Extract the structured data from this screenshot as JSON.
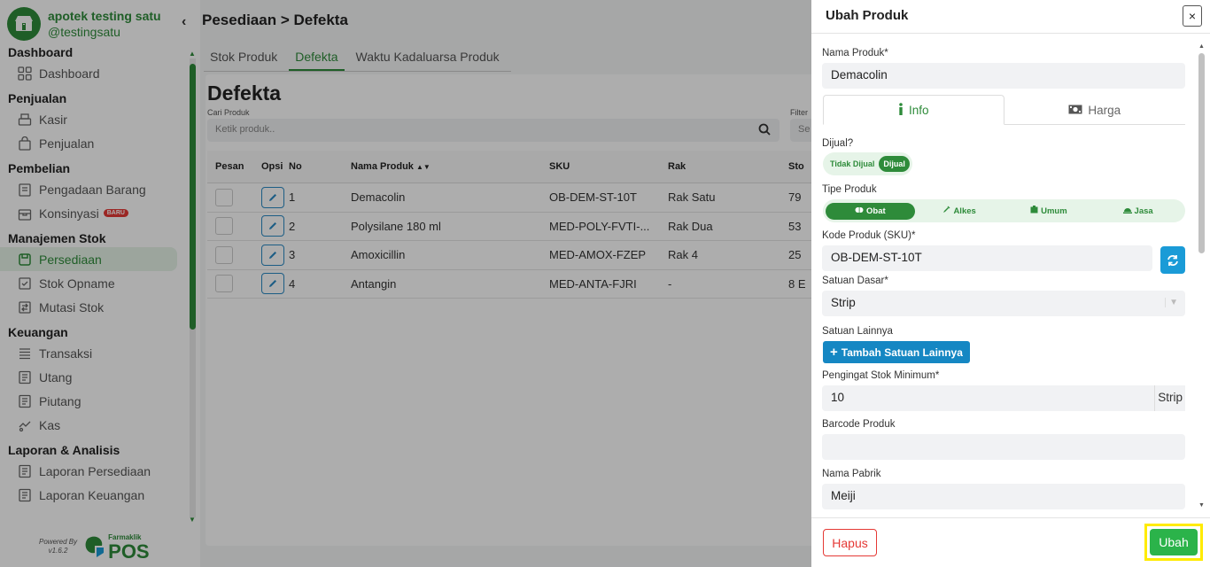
{
  "app": {
    "brand_name": "apotek testing satu",
    "brand_user": "@testingsatu"
  },
  "sidebar": {
    "groups": [
      {
        "title": "Dashboard",
        "items": [
          {
            "label": "Dashboard"
          }
        ]
      },
      {
        "title": "Penjualan",
        "items": [
          {
            "label": "Kasir"
          },
          {
            "label": "Penjualan"
          }
        ]
      },
      {
        "title": "Pembelian",
        "items": [
          {
            "label": "Pengadaan Barang"
          },
          {
            "label": "Konsinyasi",
            "badge": "BARU"
          }
        ]
      },
      {
        "title": "Manajemen Stok",
        "items": [
          {
            "label": "Persediaan",
            "active": true
          },
          {
            "label": "Stok Opname"
          },
          {
            "label": "Mutasi Stok"
          }
        ]
      },
      {
        "title": "Keuangan",
        "items": [
          {
            "label": "Transaksi"
          },
          {
            "label": "Utang"
          },
          {
            "label": "Piutang"
          },
          {
            "label": "Kas"
          }
        ]
      },
      {
        "title": "Laporan & Analisis",
        "items": [
          {
            "label": "Laporan Persediaan"
          },
          {
            "label": "Laporan Keuangan"
          }
        ]
      }
    ],
    "powered_by": "Powered By",
    "version": "v1.6.2",
    "footer_brand_small": "Farmaklik",
    "footer_brand_big": "POS"
  },
  "page": {
    "breadcrumb": "Pesediaan > Defekta",
    "tabs": [
      {
        "label": "Stok Produk"
      },
      {
        "label": "Defekta",
        "active": true
      },
      {
        "label": "Waktu Kadaluarsa Produk"
      }
    ],
    "title": "Defekta",
    "search_label": "Cari Produk",
    "search_placeholder": "Ketik produk..",
    "filter_label": "Filter",
    "filter_value": "Se",
    "table": {
      "headers": {
        "pesan": "Pesan",
        "opsi": "Opsi",
        "no": "No",
        "nama": "Nama Produk",
        "sku": "SKU",
        "rak": "Rak",
        "stok": "Sto"
      },
      "rows": [
        {
          "no": "1",
          "nama": "Demacolin",
          "sku": "OB-DEM-ST-10T",
          "rak": "Rak Satu",
          "stok": "79"
        },
        {
          "no": "2",
          "nama": "Polysilane 180 ml",
          "sku": "MED-POLY-FVTI-...",
          "rak": "Rak Dua",
          "stok": "53"
        },
        {
          "no": "3",
          "nama": "Amoxicillin",
          "sku": "MED-AMOX-FZEP",
          "rak": "Rak 4",
          "stok": "25"
        },
        {
          "no": "4",
          "nama": "Antangin",
          "sku": "MED-ANTA-FJRI",
          "rak": "-",
          "stok": "8 E"
        }
      ]
    }
  },
  "modal": {
    "title": "Ubah Produk",
    "close_label": "×",
    "nama_produk_label": "Nama Produk*",
    "nama_produk_value": "Demacolin",
    "tab_info": "Info",
    "tab_harga": "Harga",
    "dijual_label": "Dijual?",
    "toggle_off": "Tidak Dijual",
    "toggle_on": "Dijual",
    "tipe_label": "Tipe Produk",
    "tipe_options": [
      {
        "label": "Obat",
        "active": true,
        "icon": "pills-icon"
      },
      {
        "label": "Alkes",
        "icon": "syringe-icon"
      },
      {
        "label": "Umum",
        "icon": "box-icon"
      },
      {
        "label": "Jasa",
        "icon": "tray-icon"
      }
    ],
    "sku_label": "Kode Produk (SKU)*",
    "sku_value": "OB-DEM-ST-10T",
    "satuan_dasar_label": "Satuan Dasar*",
    "satuan_dasar_value": "Strip",
    "satuan_lainnya_label": "Satuan Lainnya",
    "tambah_satuan_label": "Tambah Satuan Lainnya",
    "pengingat_label": "Pengingat Stok Minimum*",
    "pengingat_value": "10",
    "pengingat_unit": "Strip",
    "barcode_label": "Barcode Produk",
    "barcode_value": "",
    "pabrik_label": "Nama Pabrik",
    "pabrik_value": "Meiji",
    "hapus_label": "Hapus",
    "ubah_label": "Ubah"
  },
  "colors": {
    "brand_green": "#2e8b3a",
    "info_blue": "#1a9bd7",
    "danger_red": "#e53935",
    "highlight_yellow": "#ffeb00"
  }
}
